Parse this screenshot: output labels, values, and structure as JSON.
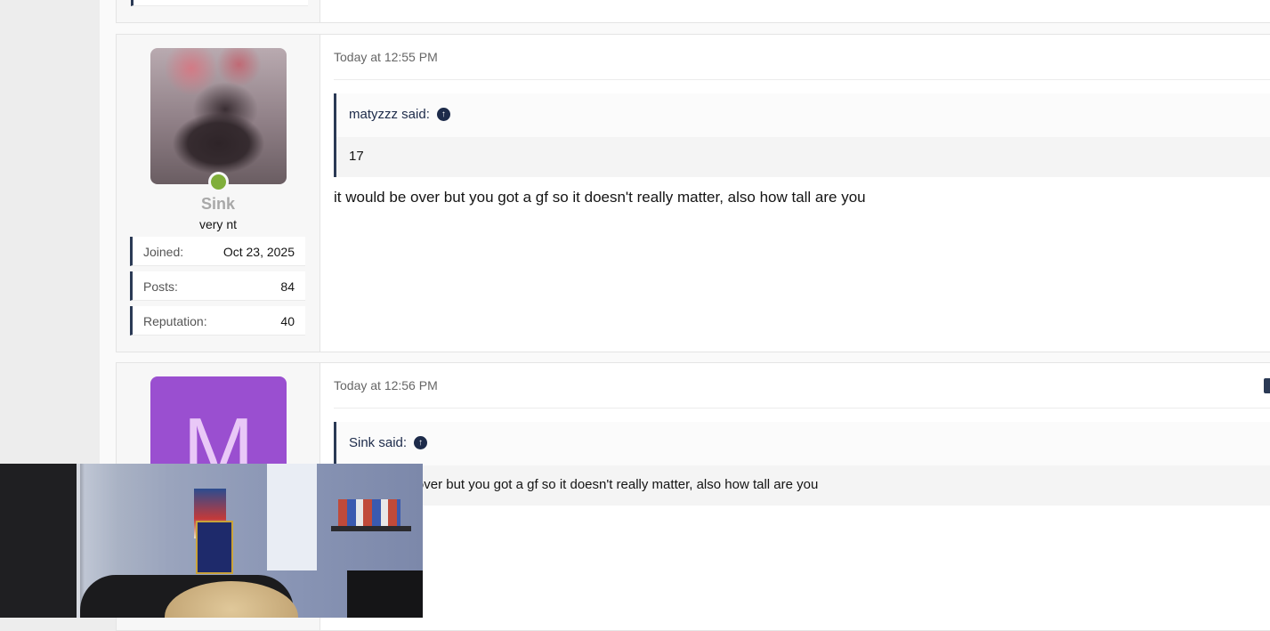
{
  "posts": [
    {
      "user": {
        "name": "Sink",
        "title": "very nt",
        "online": true,
        "stats": [
          {
            "label": "Joined:",
            "value": "Oct 23, 2025"
          },
          {
            "label": "Posts:",
            "value": "84"
          },
          {
            "label": "Reputation:",
            "value": "40"
          }
        ]
      },
      "timestamp": "Today at 12:55 PM",
      "quote": {
        "author_said": "matyzzz said:",
        "text": "17"
      },
      "message": "it would be over but you got a gf so it doesn't really matter, also how tall are you"
    },
    {
      "user": {
        "avatar_letter": "M",
        "avatar_color": "#9a4fd0"
      },
      "timestamp": "Today at 12:56 PM",
      "quote": {
        "author_said": "Sink said:",
        "text": "it would be over but you got a gf so it doesn't really matter, also how tall are you"
      }
    }
  ],
  "colors": {
    "accent": "#2b3a55",
    "online": "#7fae3a"
  },
  "icons": {
    "jump_to_quote": "arrow-up-circle-icon"
  }
}
